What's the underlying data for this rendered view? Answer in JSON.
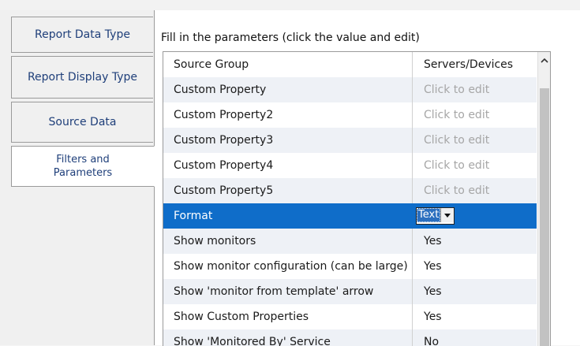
{
  "tabs": [
    {
      "label": "Report Data Type"
    },
    {
      "label": "Report Display Type"
    },
    {
      "label": "Source Data"
    },
    {
      "label": "Filters and Parameters",
      "active": true
    }
  ],
  "instructions": "Fill in the parameters (click the value and edit)",
  "grid": {
    "rows": [
      {
        "name": "Source Group",
        "value": "Servers/Devices"
      },
      {
        "name": "Custom Property",
        "value": "Click to edit",
        "placeholder": true
      },
      {
        "name": "Custom Property2",
        "value": "Click to edit",
        "placeholder": true
      },
      {
        "name": "Custom Property3",
        "value": "Click to edit",
        "placeholder": true
      },
      {
        "name": "Custom Property4",
        "value": "Click to edit",
        "placeholder": true
      },
      {
        "name": "Custom Property5",
        "value": "Click to edit",
        "placeholder": true
      },
      {
        "name": "Format",
        "value": "Text",
        "selected": true,
        "editor": "dropdown"
      },
      {
        "name": "Show monitors",
        "value": "Yes"
      },
      {
        "name": "Show monitor configuration (can be large)",
        "value": "Yes"
      },
      {
        "name": "Show 'monitor from template' arrow",
        "value": "Yes"
      },
      {
        "name": "Show Custom Properties",
        "value": "Yes"
      },
      {
        "name": "Show 'Monitored By' Service",
        "value": "No"
      }
    ]
  },
  "colors": {
    "selected_row": "#0f6dc9",
    "tab_text": "#1f3f7a",
    "placeholder_text": "#a6a6a6"
  },
  "icons": {
    "scroll_up": "chevron-up-icon",
    "dropdown": "triangle-down-icon"
  }
}
